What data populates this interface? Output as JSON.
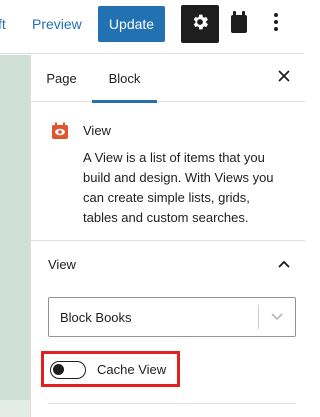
{
  "toolbar": {
    "draft_link": "ft",
    "preview_label": "Preview",
    "update_label": "Update",
    "settings_icon": "gear-icon",
    "clipboard_icon": "clipboard-icon",
    "more_icon": "vertical-ellipsis-icon"
  },
  "sidebar": {
    "tabs": [
      {
        "label": "Page",
        "active": false
      },
      {
        "label": "Block",
        "active": true
      }
    ],
    "close_icon": "close-icon",
    "block": {
      "icon": "view-block-icon",
      "title": "View",
      "description": "A View is a list of items that you build and design. With Views you can create simple lists, grids, tables and custom searches."
    },
    "panel": {
      "title": "View",
      "expanded": true,
      "toggle_icon": "chevron-up-icon",
      "select": {
        "value": "Block Books",
        "arrow_icon": "chevron-down-icon"
      },
      "cache_toggle": {
        "label": "Cache View",
        "checked": false
      }
    }
  },
  "colors": {
    "accent": "#2271b1",
    "block_icon": "#e2552c",
    "highlight_border": "#e12020",
    "canvas": "#cfe0d8"
  }
}
